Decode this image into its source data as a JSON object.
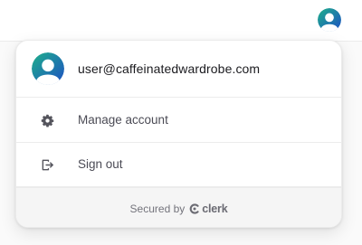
{
  "header": {
    "avatar_icon": "user-avatar-icon"
  },
  "user_menu": {
    "email": "user@caffeinatedwardrobe.com",
    "avatar_icon": "user-avatar-icon",
    "items": [
      {
        "label": "Manage account",
        "icon": "gear-icon"
      },
      {
        "label": "Sign out",
        "icon": "sign-out-icon"
      }
    ],
    "footer": {
      "secured_text": "Secured by",
      "brand": "clerk",
      "brand_icon": "clerk-logo-icon"
    }
  },
  "colors": {
    "avatar_gradient_start": "#1fb08a",
    "avatar_gradient_end": "#1d4fc4",
    "text_primary": "#1b1b1f",
    "text_secondary": "#4b4b55",
    "footer_bg": "#f5f5f5"
  }
}
